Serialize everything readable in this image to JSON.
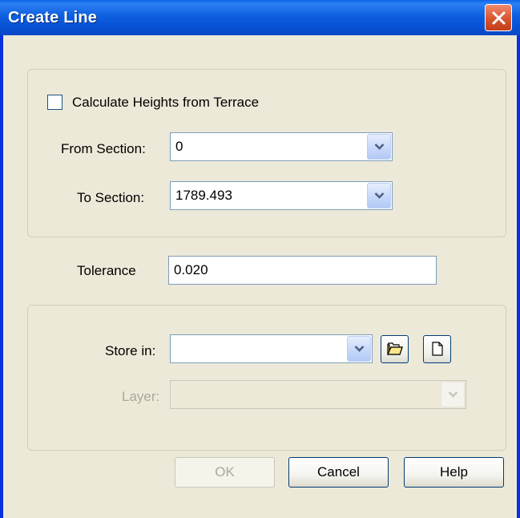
{
  "window": {
    "title": "Create Line"
  },
  "section_range": {
    "checkbox_label": "Calculate Heights from Terrace",
    "checkbox_checked": false,
    "from_label": "From Section:",
    "from_value": "0",
    "to_label": "To Section:",
    "to_value": "1789.493"
  },
  "tolerance": {
    "label": "Tolerance",
    "value": "0.020"
  },
  "storage": {
    "store_label": "Store in:",
    "store_value": "",
    "layer_label": "Layer:",
    "layer_value": ""
  },
  "buttons": {
    "ok": "OK",
    "cancel": "Cancel",
    "help": "Help"
  }
}
